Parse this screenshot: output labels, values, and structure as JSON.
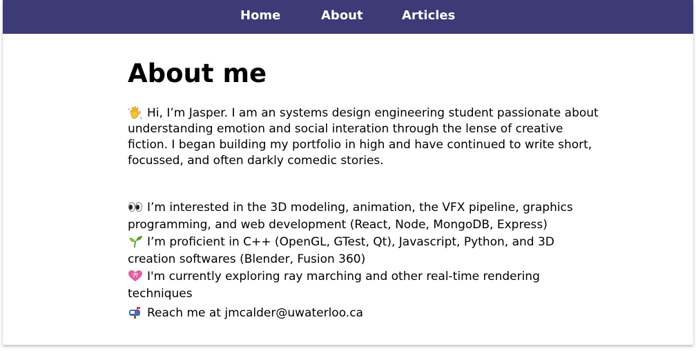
{
  "nav": {
    "home": "Home",
    "about": "About",
    "articles": "Articles"
  },
  "main": {
    "title": "About me",
    "intro": "Hi, I’m Jasper. I am an systems design engineering student passionate about understanding emotion and social interation through the lense of creative fiction. I began building my portfolio in high and have continued to write short, focussed, and often darkly comedic stories.",
    "facts": [
      {
        "icon": "eyes-icon",
        "text": "I’m interested in the 3D modeling, animation, the VFX pipeline, graphics programming, and web development (React, Node, MongoDB, Express)"
      },
      {
        "icon": "seedling-icon",
        "text": "I’m proficient in C++ (OpenGL, GTest, Qt), Javascript, Python, and 3D creation softwares (Blender, Fusion 360)"
      },
      {
        "icon": "heart-ribbon-icon",
        "text": "I'm currently exploring ray marching and other real-time rendering techniques"
      }
    ],
    "contact": {
      "icon": "mailbox-icon",
      "prefix": "Reach me at ",
      "email": "jmcalder@uwaterloo.ca"
    }
  },
  "colors": {
    "navbar": "#3c3b77",
    "nav_text": "#ffffff",
    "text": "#000000",
    "background": "#ffffff"
  }
}
